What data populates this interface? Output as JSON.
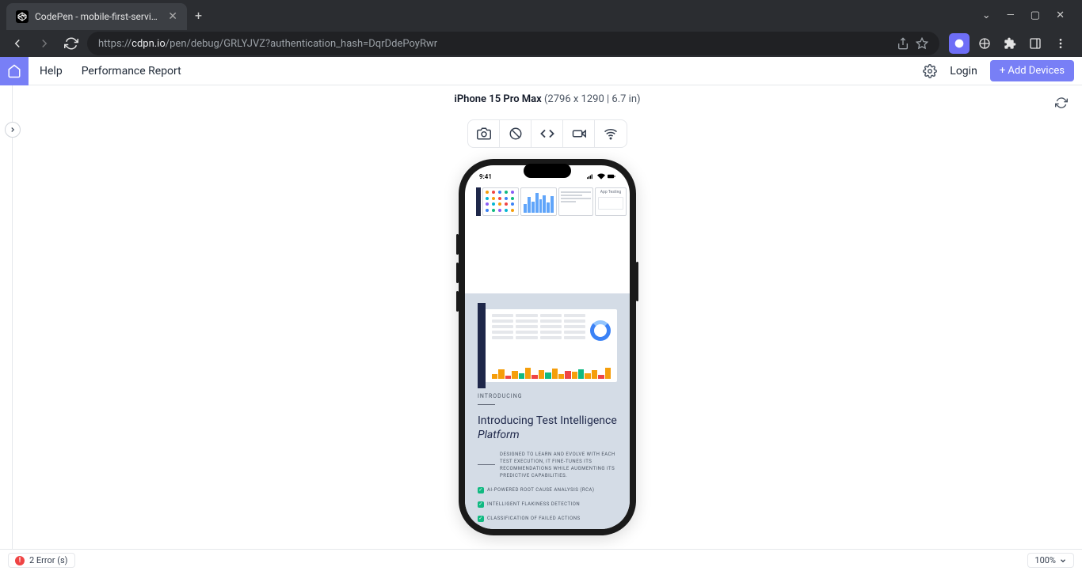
{
  "browser": {
    "tab_title": "CodePen - mobile-first-services",
    "url_prefix": "https://",
    "url_domain": "cdpn.io",
    "url_path": "/pen/debug/GRLYJVZ?authentication_hash=DqrDdePoyRwr"
  },
  "header": {
    "help": "Help",
    "perf": "Performance Report",
    "login": "Login",
    "add_devices": "+ Add Devices"
  },
  "device": {
    "name": "iPhone 15 Pro Max",
    "specs": "(2796 x 1290 | 6.7 in)"
  },
  "phone": {
    "time": "9:41",
    "hero_tag": "App Testing",
    "eyebrow": "INTRODUCING",
    "headline_1": "Introducing Test Intelligence ",
    "headline_em": "Platform",
    "desc": "DESIGNED TO LEARN AND EVOLVE WITH EACH TEST EXECUTION, IT FINE-TUNES ITS RECOMMENDATIONS WHILE AUGMENTING ITS PREDICTIVE CAPABILITIES.",
    "feat1": "AI-POWERED ROOT CAUSE ANALYSIS (RCA)",
    "feat2": "INTELLIGENT FLAKINESS DETECTION",
    "feat3": "CLASSIFICATION OF FAILED ACTIONS"
  },
  "footer": {
    "errors": "2 Error (s)",
    "zoom": "100%"
  }
}
